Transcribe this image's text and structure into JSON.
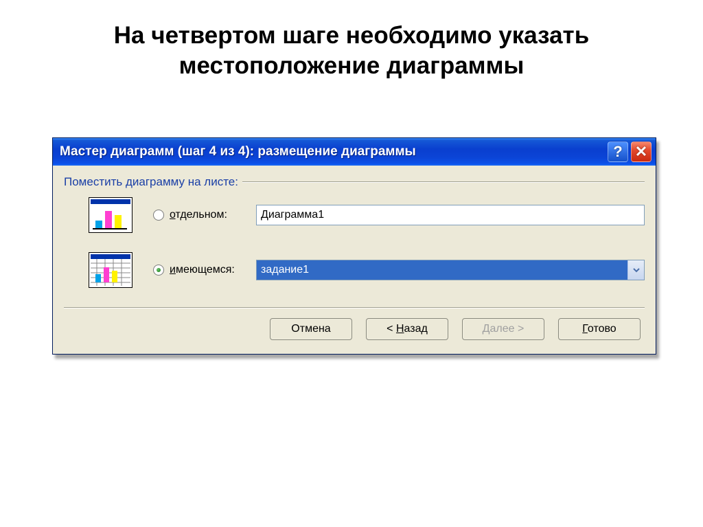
{
  "slide": {
    "title": "На четвертом шаге необходимо указать местоположение диаграммы"
  },
  "dialog": {
    "title": "Мастер диаграмм (шаг 4 из 4): размещение диаграммы",
    "group_label": "Поместить диаграмму на листе:",
    "option_new": {
      "label_pre": "",
      "label_u": "о",
      "label_post": "тдельном:",
      "value": "Диаграмма1",
      "selected": false
    },
    "option_existing": {
      "label_pre": "",
      "label_u": "и",
      "label_post": "меющемся:",
      "value": "задание1",
      "selected": true
    },
    "buttons": {
      "cancel": "Отмена",
      "back_pre": "< ",
      "back_u": "Н",
      "back_post": "азад",
      "next_pre": "",
      "next_u": "Д",
      "next_post": "алее >",
      "finish_pre": "",
      "finish_u": "Г",
      "finish_post": "отово"
    }
  }
}
